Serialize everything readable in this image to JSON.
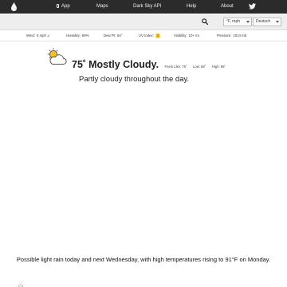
{
  "nav": {
    "app_label": "App",
    "maps_label": "Maps",
    "api_label": "Dark Sky API",
    "help_label": "Help",
    "about_label": "About"
  },
  "search": {
    "value": "",
    "placeholder": ""
  },
  "settings": {
    "units": "°F, mph",
    "language": "Deutsch"
  },
  "conditions": {
    "wind": {
      "label": "Wind:",
      "value": "6 mph",
      "arrow": "↙"
    },
    "humidity": {
      "label": "Humidity:",
      "value": "69%"
    },
    "dew_pt": {
      "label": "Dew Pt:",
      "value": "64°"
    },
    "uv_index": {
      "label": "UV Index:",
      "value": "4"
    },
    "visibility": {
      "label": "Visibility:",
      "value": "10+ mi"
    },
    "pressure": {
      "label": "Pressure:",
      "value": "1014 mb"
    }
  },
  "current": {
    "icon": "partly-cloudy-day-icon",
    "temperature": "75˚",
    "summary": "Mostly Cloudy.",
    "feels_like_label": "Feels Like:",
    "feels_like": "76˚",
    "low_label": "Low:",
    "low": "68˚",
    "high_label": "High:",
    "high": "85˚",
    "day_summary": "Partly cloudy throughout the day."
  },
  "week_summary": "Possible light rain today and next Wednesday, with high temperatures rising to 91°F on Monday.",
  "colors": {
    "nav_bg": "#2b2b2b",
    "search_bg": "#eeeeee",
    "uv_badge": "#f5d33b",
    "sun": "#f5c02a"
  }
}
